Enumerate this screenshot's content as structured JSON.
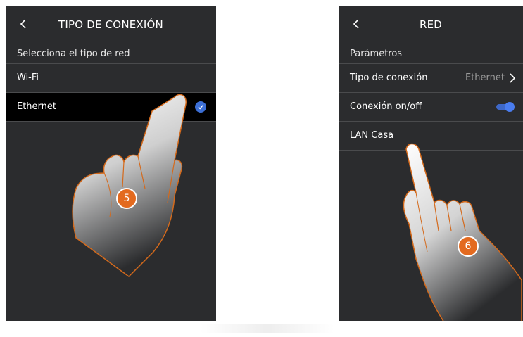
{
  "left_screen": {
    "title": "TIPO DE CONEXIÓN",
    "section_label": "Selecciona el tipo de red",
    "options": [
      {
        "label": "Wi-Fi",
        "selected": false
      },
      {
        "label": "Ethernet",
        "selected": true
      }
    ],
    "step_number": "5"
  },
  "right_screen": {
    "title": "RED",
    "section_label": "Parámetros",
    "rows": [
      {
        "label": "Tipo de conexión",
        "value": "Ethernet"
      },
      {
        "label": "Conexión on/off",
        "toggle_on": true
      },
      {
        "label": "LAN Casa"
      }
    ],
    "step_number": "6"
  },
  "icons": [
    "back-chevron-icon",
    "check-icon",
    "chevron-right-icon",
    "toggle-switch",
    "pointing-hand-icon"
  ],
  "colors": {
    "screen_bg": "#2b2c2e",
    "selected_row_bg": "#000000",
    "accent_blue": "#3c6fd6",
    "step_badge": "#e36a1f",
    "hand_outline": "#d46a1c"
  }
}
